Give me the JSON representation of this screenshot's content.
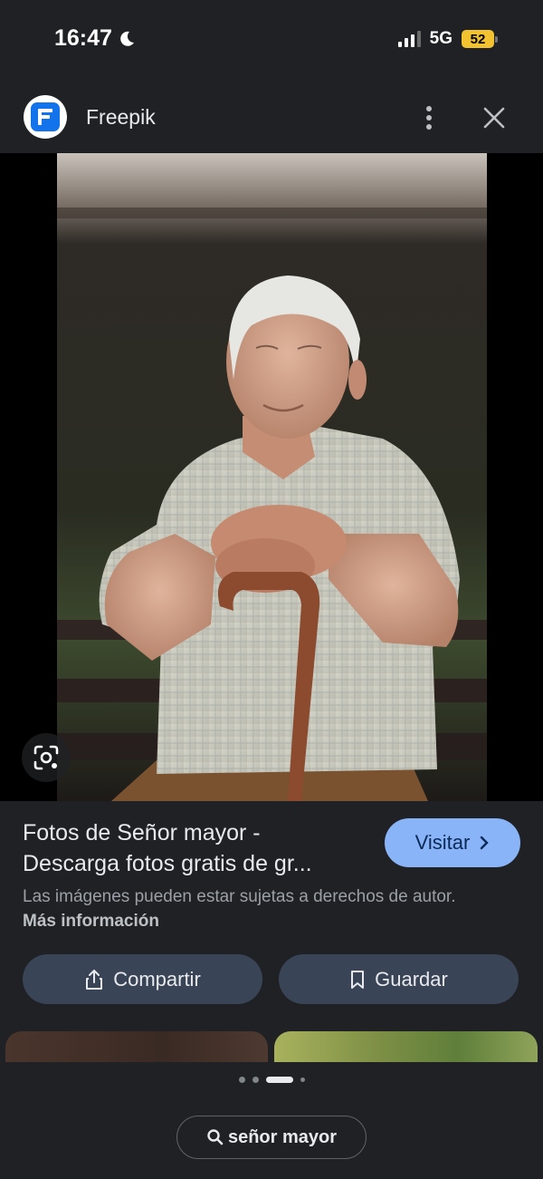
{
  "status_bar": {
    "time": "16:47",
    "network": "5G",
    "battery": "52",
    "battery_color": "#f2c230",
    "icons": [
      "moon-icon",
      "signal-icon",
      "battery-icon"
    ]
  },
  "header": {
    "site_name": "Freepik",
    "icons": [
      "freepik-logo-icon",
      "more-vert-icon",
      "close-icon"
    ]
  },
  "viewer": {
    "lens_icon": "google-lens-icon"
  },
  "result": {
    "title_line1": "Fotos de Señor mayor -",
    "title_line2": "Descarga fotos gratis de gr...",
    "visit_label": "Visitar",
    "rights_text": "Las imágenes pueden estar sujetas a derechos de autor.",
    "more_info": "Más información",
    "share_label": "Compartir",
    "save_label": "Guardar",
    "accent_color": "#8ab4f8"
  },
  "search": {
    "query": "señor mayor",
    "icon": "search-icon"
  }
}
